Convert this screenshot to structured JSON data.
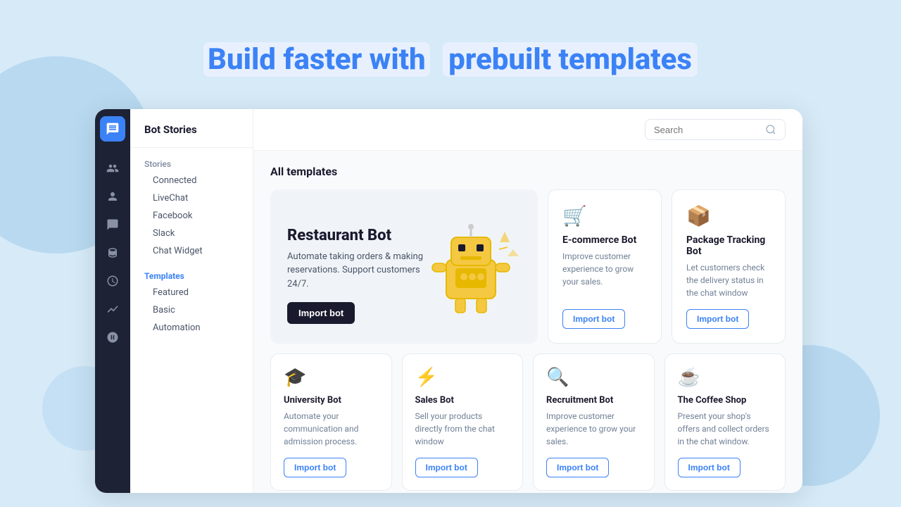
{
  "page": {
    "header": {
      "prefix": "Build faster with",
      "highlight": "prebuilt templates"
    }
  },
  "sidebar": {
    "app_title": "Bot Stories",
    "nav": {
      "stories_label": "Stories",
      "stories_items": [
        "Connected",
        "LiveChat",
        "Facebook",
        "Slack",
        "Chat Widget"
      ],
      "templates_label": "Templates",
      "templates_items": [
        "Featured",
        "Basic",
        "Automation"
      ]
    }
  },
  "toolbar": {
    "search_placeholder": "Search"
  },
  "templates": {
    "section_title": "All templates",
    "featured": {
      "title": "Restaurant Bot",
      "description": "Automate taking orders & making reservations. Support customers 24/7.",
      "btn": "Import bot"
    },
    "cards": [
      {
        "icon": "🛒",
        "title": "E-commerce Bot",
        "description": "Improve customer experience to grow your sales.",
        "btn": "Import bot"
      },
      {
        "icon": "📦",
        "title": "Package Tracking Bot",
        "description": "Let customers check the delivery status in the chat window",
        "btn": "Import bot"
      }
    ],
    "bottom_cards": [
      {
        "icon": "🎓",
        "title": "University Bot",
        "description": "Automate your communication and admission process.",
        "btn": "Import bot"
      },
      {
        "icon": "⚡",
        "title": "Sales Bot",
        "description": "Sell your products directly from the chat window",
        "btn": "Import bot"
      },
      {
        "icon": "🔍",
        "title": "Recruitment Bot",
        "description": "Improve customer experience to grow your sales.",
        "btn": "Import bot"
      },
      {
        "icon": "☕",
        "title": "The Coffee Shop",
        "description": "Present your shop's offers and collect orders in the chat window.",
        "btn": "Import bot"
      }
    ]
  }
}
